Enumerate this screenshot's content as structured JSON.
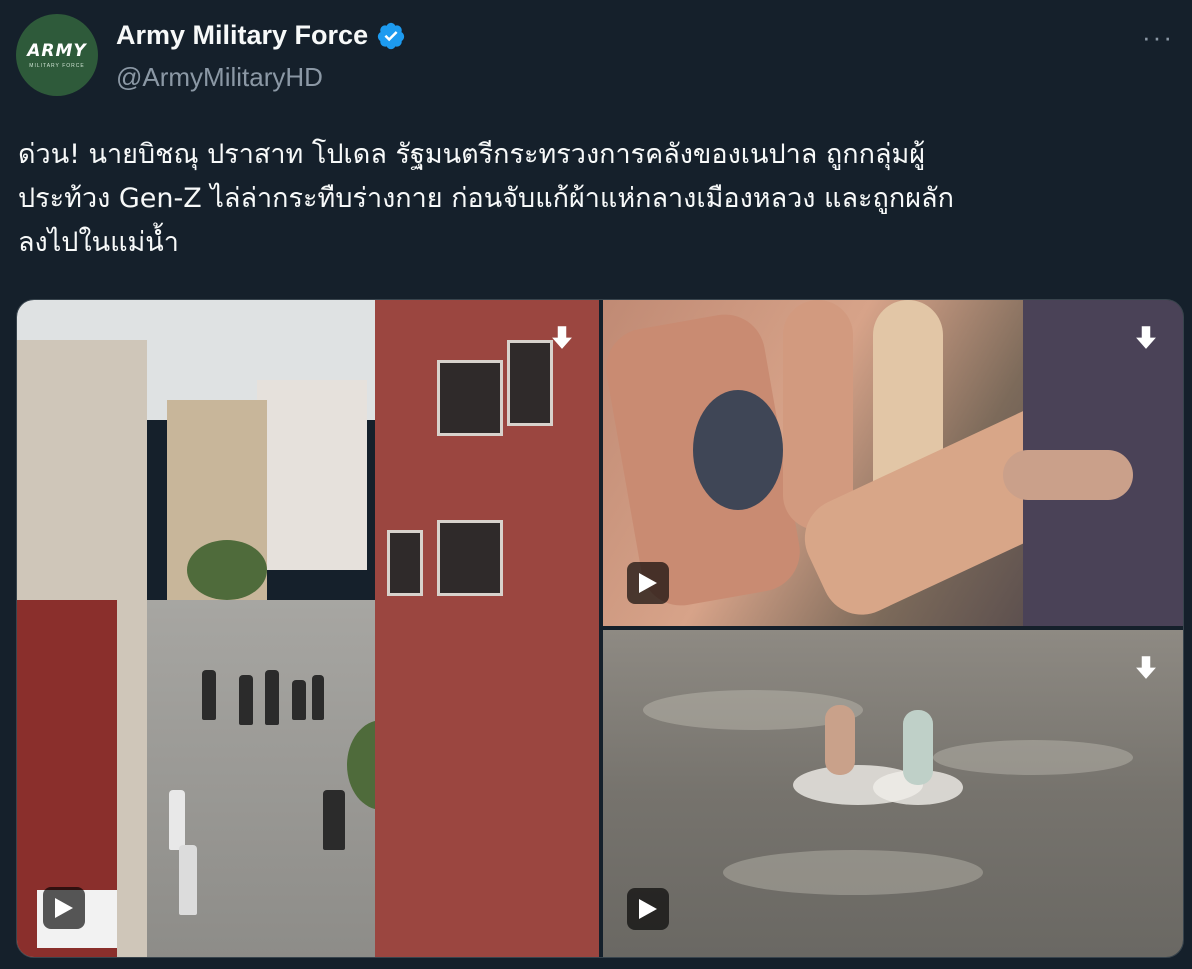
{
  "account": {
    "display_name": "Army Military Force",
    "handle": "@ArmyMilitaryHD",
    "avatar_logo_text": "ARMY",
    "avatar_logo_subtext": "MILITARY FORCE",
    "verified": true,
    "verified_color": "#1d9bf0"
  },
  "header": {
    "more_icon": "more-horizontal-icon",
    "more_label": "···"
  },
  "tweet": {
    "text": "ด่วน! นายบิชณุ ปราสาท โปเดล รัฐมนตรีกระทรวงการคลังของเนปาล ถูกกลุ่มผู้\nประท้วง Gen-Z ไล่ล่ากระทืบร่างกาย ก่อนจับแก้ผ้าแห่กลางเมืองหลวง และถูกผลัก\nลงไปในแม่น้ำ"
  },
  "media": [
    {
      "type": "video",
      "icon_download": "download-icon",
      "icon_play": "play-icon"
    },
    {
      "type": "video",
      "icon_download": "download-icon",
      "icon_play": "play-icon"
    },
    {
      "type": "video",
      "icon_download": "download-icon",
      "icon_play": "play-icon"
    }
  ],
  "colors": {
    "background": "#15202b",
    "primary_text": "#f7f9f9",
    "secondary_text": "#8b98a5",
    "avatar_bg": "#2e5a3a"
  }
}
